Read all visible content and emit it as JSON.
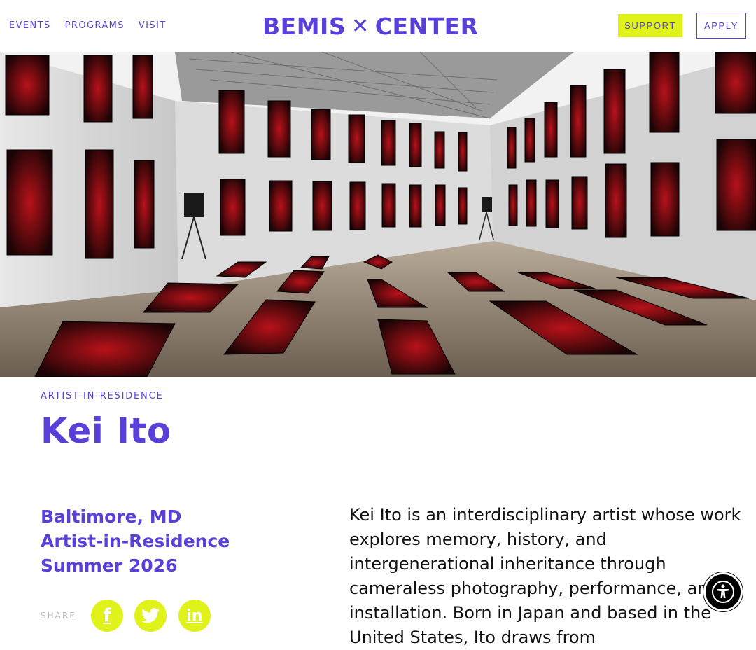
{
  "header": {
    "nav": [
      "EVENTS",
      "PROGRAMS",
      "VISIT"
    ],
    "logo_left": "BEMIS",
    "logo_mark": "✕",
    "logo_right": "CENTER",
    "support_label": "SUPPORT",
    "apply_label": "APPLY"
  },
  "hero": {
    "alt": "Installation view: gallery with red figure prints on walls and floor"
  },
  "artist": {
    "eyebrow": "ARTIST-IN-RESIDENCE",
    "name": "Kei Ito",
    "meta": [
      "Baltimore, MD",
      "Artist-in-Residence",
      "Summer 2026"
    ],
    "share_label": "SHARE",
    "social": [
      {
        "icon": "facebook-icon",
        "glyph": "f"
      },
      {
        "icon": "twitter-icon",
        "glyph": "🐦"
      },
      {
        "icon": "linkedin-icon",
        "glyph": "in"
      }
    ],
    "bio": "Kei Ito is an interdisciplinary artist whose work explores memory, history, and intergenerational inheritance through cameraless photography, performance, and installation. Born in Japan and based in the United States, Ito draws from"
  },
  "colors": {
    "brand": "#5b3fd9",
    "accent": "#dff21a"
  }
}
